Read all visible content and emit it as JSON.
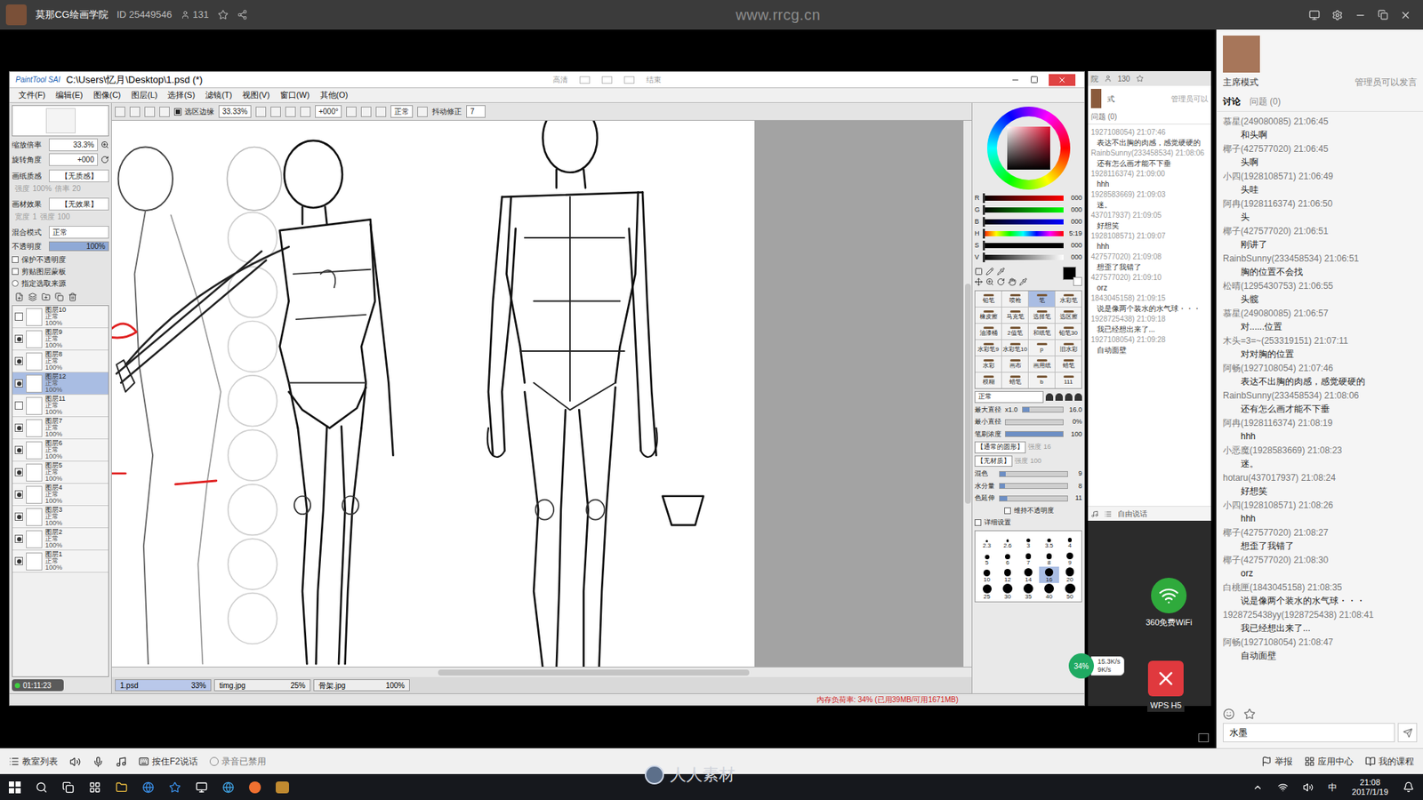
{
  "header": {
    "channel": "莫那CG绘画学院",
    "id": "ID 25449546",
    "viewers": "131",
    "watermark": "www.rrcg.cn"
  },
  "sai": {
    "logo": "PaintTool SAI",
    "title": "C:\\Users\\忆月\\Desktop\\1.psd (*)",
    "title_actions": [
      "高清",
      "结束"
    ],
    "menu": [
      "文件(F)",
      "编辑(E)",
      "图像(C)",
      "图层(L)",
      "选择(S)",
      "滤镜(T)",
      "视图(V)",
      "窗口(W)",
      "其他(O)"
    ],
    "toolbar": {
      "selection_edge": {
        "label": "选区边缘",
        "checked": true
      },
      "zoom": "33.33%",
      "angle": "+000°",
      "mode": "正常",
      "stabilizer_label": "抖动修正",
      "stabilizer": "7"
    },
    "nav": {
      "zoom_label": "缩放倍率",
      "zoom": "33.3%",
      "rotate_label": "旋转角度",
      "rotate": "+000"
    },
    "paper": {
      "label": "画纸质感",
      "value": "【无质感】",
      "sub": [
        "强度",
        "100%",
        "倍率",
        "20"
      ]
    },
    "effect": {
      "label": "画材效果",
      "value": "【无效果】",
      "sub": [
        "宽度",
        "1",
        "强度",
        "100"
      ]
    },
    "blend": {
      "label": "混合模式",
      "value": "正常"
    },
    "opacity": {
      "label": "不透明度",
      "value": "100%",
      "level": 1
    },
    "options": [
      {
        "label": "保护不透明度",
        "checked": false,
        "kind": "checkbox"
      },
      {
        "label": "剪贴图层蒙板",
        "checked": false,
        "kind": "checkbox"
      },
      {
        "label": "指定选取来源",
        "checked": false,
        "kind": "radio"
      }
    ],
    "layers": [
      {
        "name": "图层10",
        "mode": "正常",
        "opacity": "100%",
        "visible": false,
        "selected": false
      },
      {
        "name": "图层9",
        "mode": "正常",
        "opacity": "100%",
        "visible": true,
        "selected": false
      },
      {
        "name": "图层8",
        "mode": "正常",
        "opacity": "100%",
        "visible": true,
        "selected": false
      },
      {
        "name": "图层12",
        "mode": "正常",
        "opacity": "100%",
        "visible": true,
        "selected": true
      },
      {
        "name": "图层11",
        "mode": "正常",
        "opacity": "100%",
        "visible": false,
        "selected": false
      },
      {
        "name": "图层7",
        "mode": "正常",
        "opacity": "100%",
        "visible": true,
        "selected": false
      },
      {
        "name": "图层6",
        "mode": "正常",
        "opacity": "100%",
        "visible": true,
        "selected": false
      },
      {
        "name": "图层5",
        "mode": "正常",
        "opacity": "100%",
        "visible": true,
        "selected": false
      },
      {
        "name": "图层4",
        "mode": "正常",
        "opacity": "100%",
        "visible": true,
        "selected": false
      },
      {
        "name": "图层3",
        "mode": "正常",
        "opacity": "100%",
        "visible": true,
        "selected": false
      },
      {
        "name": "图层2",
        "mode": "正常",
        "opacity": "100%",
        "visible": true,
        "selected": false
      },
      {
        "name": "图层1",
        "mode": "正常",
        "opacity": "100%",
        "visible": true,
        "selected": false
      }
    ],
    "timer": "01:11:23",
    "tabs": [
      {
        "name": "1.psd",
        "zoom": "33%",
        "selected": true
      },
      {
        "name": "timg.jpg",
        "zoom": "25%",
        "selected": false
      },
      {
        "name": "骨架.jpg",
        "zoom": "100%",
        "selected": false
      }
    ],
    "colors": [
      {
        "label": "R",
        "value": "000",
        "level": 0
      },
      {
        "label": "G",
        "value": "000",
        "level": 0
      },
      {
        "label": "B",
        "value": "000",
        "level": 0
      },
      {
        "label": "H",
        "value": "5:19",
        "level": 0
      },
      {
        "label": "S",
        "value": "000",
        "level": 0
      },
      {
        "label": "V",
        "value": "000",
        "level": 0
      }
    ],
    "tools": [
      {
        "label": "铅笔",
        "selected": false
      },
      {
        "label": "喷枪",
        "selected": false
      },
      {
        "label": "笔",
        "selected": true
      },
      {
        "label": "水彩笔",
        "selected": false
      },
      {
        "label": "橡皮擦",
        "selected": false
      },
      {
        "label": "马克笔",
        "selected": false
      },
      {
        "label": "选择笔",
        "selected": false
      },
      {
        "label": "选区擦",
        "selected": false
      },
      {
        "label": "油漆桶",
        "selected": false
      },
      {
        "label": "2值笔",
        "selected": false
      },
      {
        "label": "和纸笔",
        "selected": false
      },
      {
        "label": "铅笔30",
        "selected": false
      },
      {
        "label": "水彩笔9",
        "selected": false
      },
      {
        "label": "水彩笔10",
        "selected": false
      },
      {
        "label": "p",
        "selected": false
      },
      {
        "label": "旧水彩",
        "selected": false
      },
      {
        "label": "水彩",
        "selected": false
      },
      {
        "label": "画布",
        "selected": false
      },
      {
        "label": "画用纸",
        "selected": false
      },
      {
        "label": "蜡笔",
        "selected": false
      },
      {
        "label": "模糊",
        "selected": false
      },
      {
        "label": "蜡笔",
        "selected": false
      },
      {
        "label": "b",
        "selected": false
      },
      {
        "label": "111",
        "selected": false
      }
    ],
    "brush": {
      "mode": "正常",
      "max_label": "最大直径",
      "max_mult": "x1.0",
      "max": "16.0",
      "max_level": 0.16,
      "min_label": "最小直径",
      "min": "0%",
      "min_level": 0,
      "density_label": "笔刷浓度",
      "density": "100",
      "density_level": 1,
      "shape": "【通常的圆形】",
      "shape_sub": [
        "强度",
        "16"
      ],
      "texture": "【无材质】",
      "texture_sub": [
        "强度",
        "100"
      ],
      "params": [
        {
          "label": "混色",
          "value": "9",
          "level": 0.09
        },
        {
          "label": "水分量",
          "value": "8",
          "level": 0.08
        },
        {
          "label": "色延伸",
          "value": "11",
          "level": 0.11
        }
      ],
      "keep_opacity": {
        "label": "维持不透明度",
        "checked": false
      },
      "detail": {
        "label": "详细设置",
        "checked": false
      }
    },
    "sizes": [
      {
        "value": "2.3",
        "selected": false
      },
      {
        "value": "2.6",
        "selected": false
      },
      {
        "value": "3",
        "selected": false
      },
      {
        "value": "3.5",
        "selected": false
      },
      {
        "value": "4",
        "selected": false
      },
      {
        "value": "5",
        "selected": false
      },
      {
        "value": "6",
        "selected": false
      },
      {
        "value": "7",
        "selected": false
      },
      {
        "value": "8",
        "selected": false
      },
      {
        "value": "9",
        "selected": false
      },
      {
        "value": "10",
        "selected": false
      },
      {
        "value": "12",
        "selected": false
      },
      {
        "value": "14",
        "selected": false
      },
      {
        "value": "16",
        "selected": true
      },
      {
        "value": "20",
        "selected": false
      },
      {
        "value": "25",
        "selected": false
      },
      {
        "value": "30",
        "selected": false
      },
      {
        "value": "35",
        "selected": false
      },
      {
        "value": "40",
        "selected": false
      },
      {
        "value": "50",
        "selected": false
      }
    ],
    "status": "内存负荷率: 34% (已用39MB/可用1671MB)"
  },
  "inner_chat": {
    "title": "院",
    "count": "130",
    "mode": "式",
    "note": "管理员可以",
    "tab": "问题 (0)",
    "lines": [
      {
        "text": "1927108054) 21:07:46",
        "kind": "meta"
      },
      {
        "text": "表达不出胸的肉感，感觉硬硬的",
        "kind": "text"
      },
      {
        "text": "RainbSunny(233458534) 21:08:06",
        "kind": "meta"
      },
      {
        "text": "还有怎么画才能不下垂",
        "kind": "text"
      },
      {
        "text": "1928116374) 21:09:00",
        "kind": "meta"
      },
      {
        "text": "hhh",
        "kind": "text"
      },
      {
        "text": "1928583669) 21:09:03",
        "kind": "meta"
      },
      {
        "text": "迷。",
        "kind": "text"
      },
      {
        "text": "437017937) 21:09:05",
        "kind": "meta"
      },
      {
        "text": "好想笑",
        "kind": "text"
      },
      {
        "text": "1928108571) 21:09:07",
        "kind": "meta"
      },
      {
        "text": "hhh",
        "kind": "text"
      },
      {
        "text": "427577020) 21:09:08",
        "kind": "meta"
      },
      {
        "text": "想歪了我错了",
        "kind": "text"
      },
      {
        "text": "427577020) 21:09:10",
        "kind": "meta"
      },
      {
        "text": "orz",
        "kind": "text"
      },
      {
        "text": "1843045158) 21:09:15",
        "kind": "meta"
      },
      {
        "text": "说是像两个装水的水气球・・・",
        "kind": "text"
      },
      {
        "text": "1928725438) 21:09:18",
        "kind": "meta"
      },
      {
        "text": "我已经想出来了...",
        "kind": "text"
      },
      {
        "text": "1927108054) 21:09:28",
        "kind": "meta"
      },
      {
        "text": "自动面壁",
        "kind": "text"
      }
    ],
    "free_talk": "自由说话"
  },
  "chat": {
    "mode": "主席模式",
    "note": "管理员可以发言",
    "tabs": [
      {
        "label": "讨论",
        "selected": true
      },
      {
        "label": "问题 (0)",
        "selected": false
      }
    ],
    "messages": [
      {
        "user": "慕星(249080085)",
        "time": "21:06:45",
        "text": "和头啊"
      },
      {
        "user": "椰子(427577020)",
        "time": "21:06:45",
        "text": "头啊"
      },
      {
        "user": "小四(1928108571)",
        "time": "21:06:49",
        "text": "头哇"
      },
      {
        "user": "阿冉(1928116374)",
        "time": "21:06:50",
        "text": "头"
      },
      {
        "user": "椰子(427577020)",
        "time": "21:06:51",
        "text": "刚讲了"
      },
      {
        "user": "RainbSunny(233458534)",
        "time": "21:06:51",
        "text": "胸的位置不会找"
      },
      {
        "user": "松晴(1295430753)",
        "time": "21:06:55",
        "text": "头髋"
      },
      {
        "user": "慕星(249080085)",
        "time": "21:06:57",
        "text": "对......位置"
      },
      {
        "user": "木头=3=~(253319151)",
        "time": "21:07:11",
        "text": "对对胸的位置"
      },
      {
        "user": "阿畅(1927108054)",
        "time": "21:07:46",
        "text": "表达不出胸的肉感，感觉硬硬的"
      },
      {
        "user": "RainbSunny(233458534)",
        "time": "21:08:06",
        "text": "还有怎么画才能不下垂"
      },
      {
        "user": "阿冉(1928116374)",
        "time": "21:08:19",
        "text": "hhh"
      },
      {
        "user": "小恶魔(1928583669)",
        "time": "21:08:23",
        "text": "迷。"
      },
      {
        "user": "hotaru(437017937)",
        "time": "21:08:24",
        "text": "好想笑"
      },
      {
        "user": "小四(1928108571)",
        "time": "21:08:26",
        "text": "hhh"
      },
      {
        "user": "椰子(427577020)",
        "time": "21:08:27",
        "text": "想歪了我错了"
      },
      {
        "user": "椰子(427577020)",
        "time": "21:08:30",
        "text": "orz"
      },
      {
        "user": "白桃匣(1843045158)",
        "time": "21:08:35",
        "text": "说是像两个装水的水气球・・・"
      },
      {
        "user": "1928725438yy(1928725438)",
        "time": "21:08:41",
        "text": "我已经想出来了..."
      },
      {
        "user": "阿畅(1927108054)",
        "time": "21:08:47",
        "text": "自动面壁"
      }
    ],
    "input": "水墨"
  },
  "overlays": {
    "wifi": "360免费WiFi",
    "wps": "WPS H5",
    "net_percent": "34%",
    "net_up": "15.3K/s",
    "net_down": "9K/s"
  },
  "classroom_bar": {
    "list": "教室列表",
    "talk": "按住F2说话",
    "record": "录音已禁用",
    "right": [
      "举报",
      "应用中心",
      "我的课程"
    ]
  },
  "taskbar": {
    "ime": "中",
    "time": "21:08",
    "date": "2017/1/19"
  },
  "watermark_bottom": "人人素材"
}
